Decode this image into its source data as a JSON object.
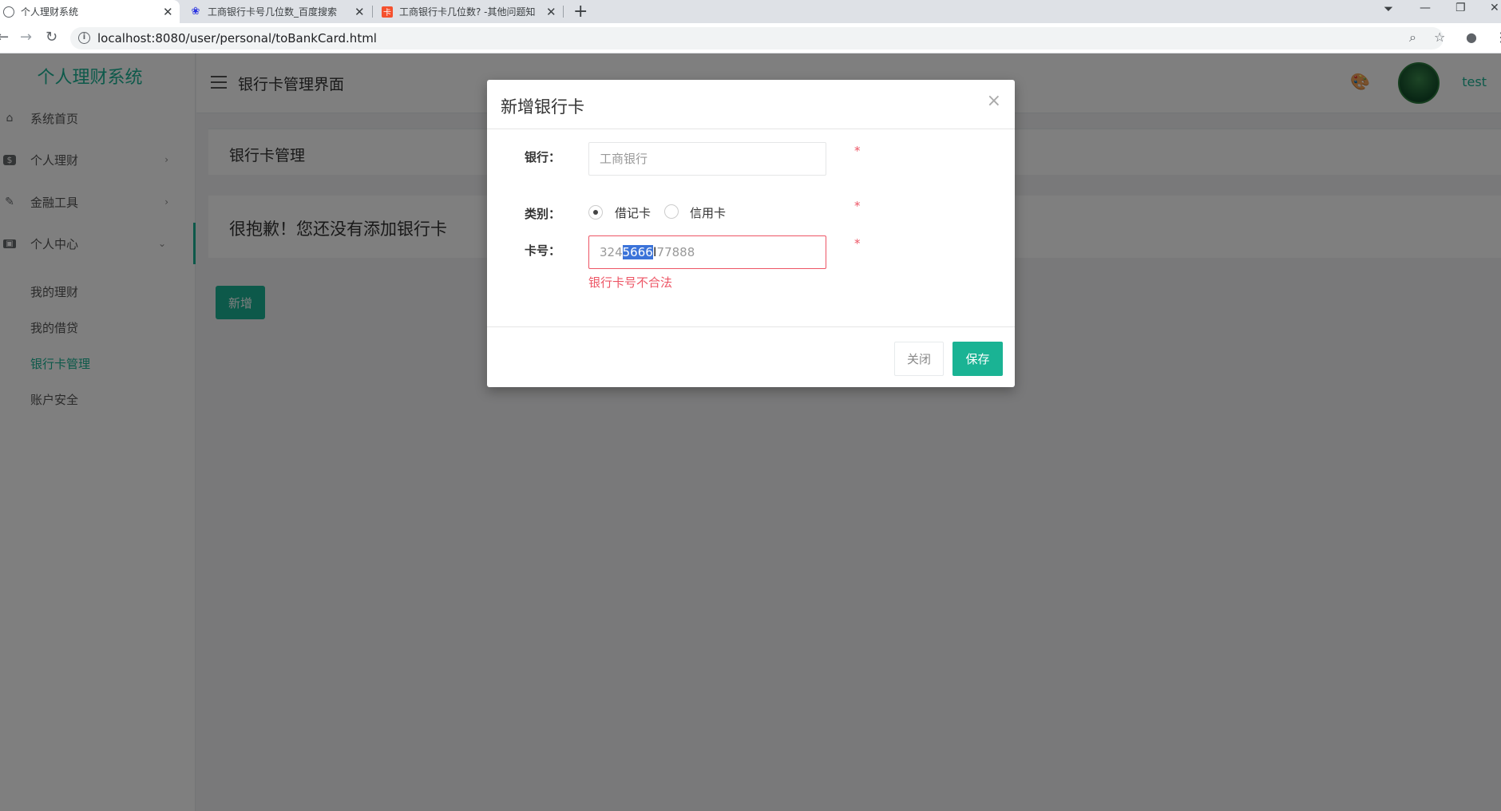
{
  "browser": {
    "tabs": [
      {
        "label": "个人理财系统",
        "active": true
      },
      {
        "label": "工商银行卡号几位数_百度搜索",
        "active": false
      },
      {
        "label": "工商银行卡几位数? -其他问题知",
        "active": false
      }
    ],
    "url": "localhost:8080/user/personal/toBankCard.html"
  },
  "sidebar": {
    "brand": "个人理财系统",
    "items": [
      {
        "label": "系统首页",
        "icon": "home-icon"
      },
      {
        "label": "个人理财",
        "icon": "dollar-icon"
      },
      {
        "label": "金融工具",
        "icon": "wrench-icon"
      },
      {
        "label": "个人中心",
        "icon": "user-card-icon"
      }
    ],
    "subitems": [
      {
        "label": "我的理财"
      },
      {
        "label": "我的借贷"
      },
      {
        "label": "银行卡管理"
      },
      {
        "label": "账户安全"
      }
    ]
  },
  "header": {
    "title": "银行卡管理界面",
    "username": "test"
  },
  "main": {
    "panel_title": "银行卡管理",
    "empty_message": "很抱歉！您还没有添加银行卡",
    "add_button": "新增"
  },
  "modal": {
    "title": "新增银行卡",
    "bank_label": "银行：",
    "bank_placeholder": "工商银行",
    "type_label": "类别：",
    "type_options": [
      "借记卡",
      "信用卡"
    ],
    "type_selected": "借记卡",
    "card_label": "卡号：",
    "card_value_before": "324",
    "card_value_selected": "5666",
    "card_value_after": "77888",
    "required_mark": "*",
    "error_message": "银行卡号不合法",
    "close_button": "关闭",
    "save_button": "保存"
  },
  "colors": {
    "accent": "#1ab394",
    "error": "#ed5565"
  }
}
